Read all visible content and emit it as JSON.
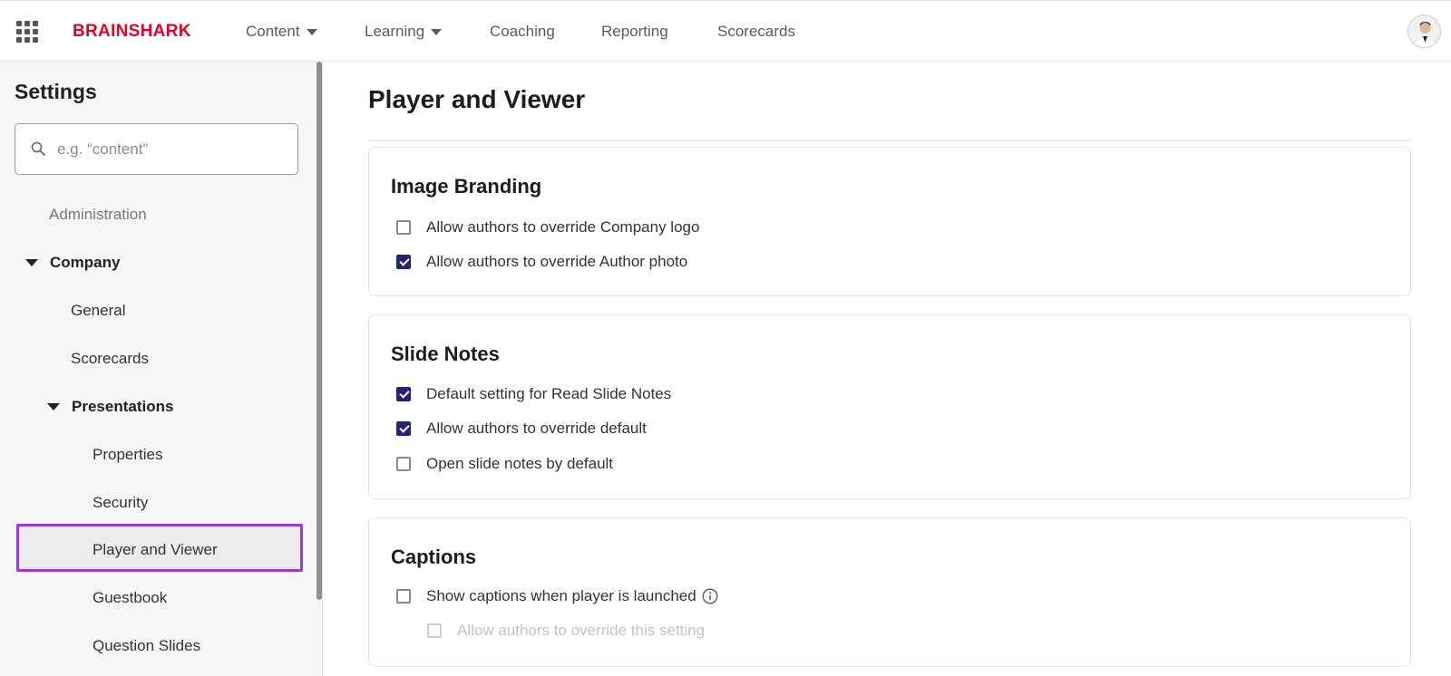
{
  "header": {
    "logo_text": "BRAINSHARK",
    "nav": [
      {
        "label": "Content",
        "dropdown": true
      },
      {
        "label": "Learning",
        "dropdown": true
      },
      {
        "label": "Coaching",
        "dropdown": false
      },
      {
        "label": "Reporting",
        "dropdown": false
      },
      {
        "label": "Scorecards",
        "dropdown": false
      }
    ]
  },
  "sidebar": {
    "title": "Settings",
    "search_placeholder": "e.g. “content”",
    "items": [
      {
        "label": "Administration",
        "level": 0,
        "expanded": false
      },
      {
        "label": "Company",
        "level": 0,
        "expanded": true
      },
      {
        "label": "General",
        "level": 1
      },
      {
        "label": "Scorecards",
        "level": 1
      },
      {
        "label": "Presentations",
        "level": 1,
        "expanded": true
      },
      {
        "label": "Properties",
        "level": 2
      },
      {
        "label": "Security",
        "level": 2
      },
      {
        "label": "Player and Viewer",
        "level": 2,
        "selected": true
      },
      {
        "label": "Guestbook",
        "level": 2
      },
      {
        "label": "Question Slides",
        "level": 2
      }
    ]
  },
  "main": {
    "title": "Player and Viewer",
    "sections": [
      {
        "title": "Image Branding",
        "options": [
          {
            "label": "Allow authors to override Company logo",
            "checked": false
          },
          {
            "label": "Allow authors to override Author photo",
            "checked": true
          }
        ]
      },
      {
        "title": "Slide Notes",
        "options": [
          {
            "label": "Default setting for Read Slide Notes",
            "checked": true
          },
          {
            "label": "Allow authors to override default",
            "checked": true
          },
          {
            "label": "Open slide notes by default",
            "checked": false
          }
        ]
      },
      {
        "title": "Captions",
        "options": [
          {
            "label": "Show captions when player is launched",
            "checked": false,
            "info": true
          },
          {
            "label": "Allow authors to override this setting",
            "checked": false,
            "disabled": true
          }
        ]
      }
    ]
  },
  "colors": {
    "brand": "#e4002b",
    "checkbox_checked": "#23237a",
    "selection_outline": "#9b3bd6"
  }
}
